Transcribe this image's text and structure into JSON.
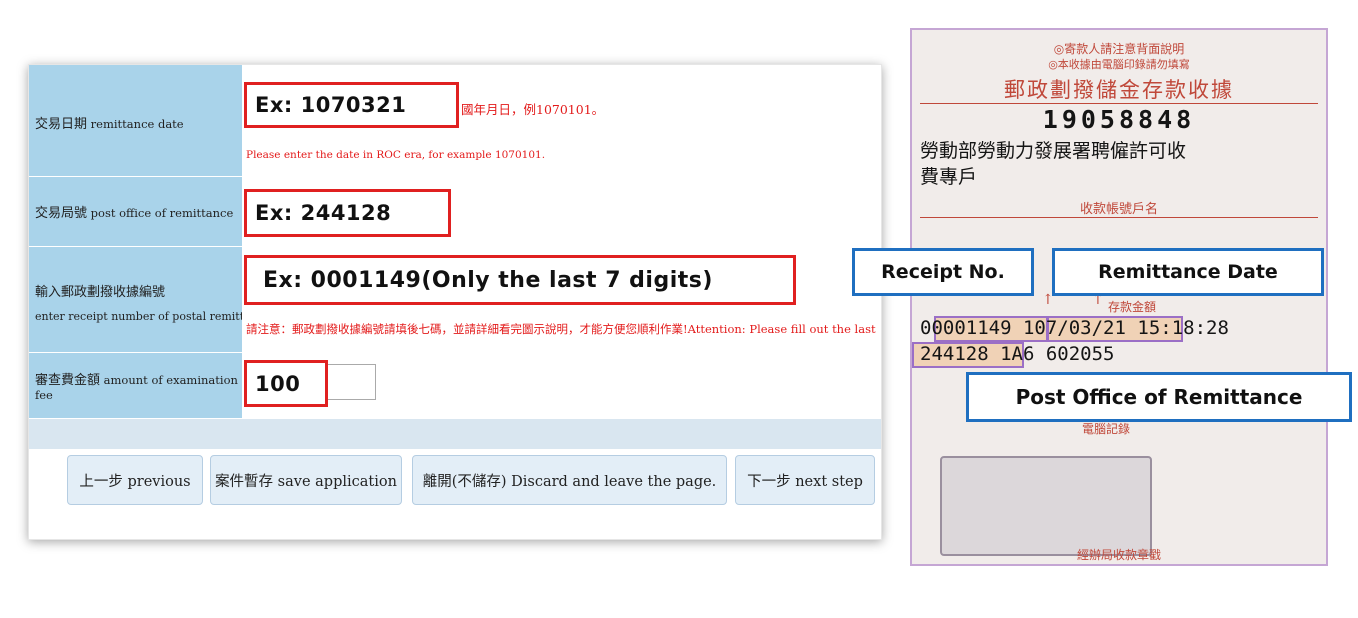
{
  "form": {
    "rows": [
      {
        "label_zh": "交易日期",
        "label_en": "remittance date",
        "example": "Ex: 1070321",
        "note_inline": "國年月日，例1070101。",
        "note_below": "Please enter the date in ROC era, for example 1070101."
      },
      {
        "label_zh": "交易局號",
        "label_en": "post office of remittance",
        "example": "Ex: 244128"
      },
      {
        "label_zh": "輸入郵政劃撥收據編號",
        "label_en": "enter receipt number of postal remittance",
        "example": "Ex: 0001149(Only the last 7 digits)",
        "note_below": "請注意：郵政劃撥收據編號請填後七碼，並請詳細看完圖示說明，才能方便您順利作業!Attention: Please fill out the last"
      },
      {
        "label_zh": "審查費金額",
        "label_en": "amount of examination fee",
        "example": "100"
      }
    ],
    "buttons": {
      "previous": "上一步 previous",
      "save": "案件暫存 save application",
      "discard": "離開(不儲存) Discard and leave the page.",
      "next": "下一步 next step"
    }
  },
  "receipt": {
    "notice1": "◎寄款人請注意背面說明",
    "notice2": "◎本收據由電腦印錄請勿填寫",
    "title": "郵政劃撥儲金存款收據",
    "account_no": "19058848",
    "account_name_1": "勞動部勞動力發展署聘僱許可收",
    "account_name_2": "費專戶",
    "account_name_label": "收款帳號戶名",
    "amount_label": "存款金額",
    "receipt_no": "0001149",
    "receipt_prefix": "0",
    "date": "107/03/21",
    "time": "15:18:28",
    "office": "244128",
    "office_rest": "1A6 602055",
    "footer": "電腦記錄",
    "stamp_label": "經辦局收款章戳",
    "callouts": {
      "receipt_no": "Receipt No.",
      "remittance_date": "Remittance Date",
      "post_office": "Post Office of Remittance"
    }
  },
  "colors": {
    "red": "#e02020",
    "blue": "#1f6fc0",
    "label_bg": "#a9d3ea"
  }
}
